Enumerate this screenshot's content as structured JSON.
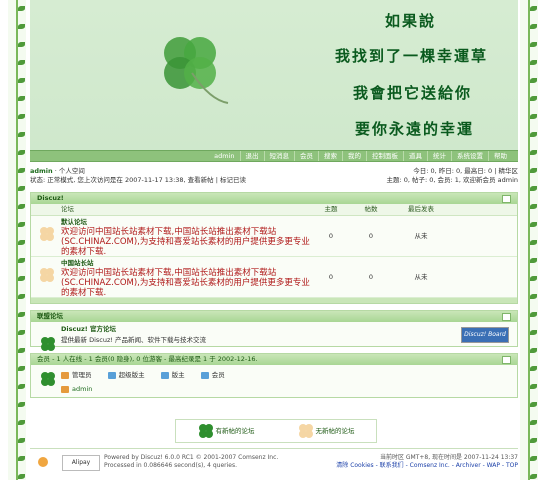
{
  "banner": {
    "poem_lines": [
      "如果說",
      "我找到了一棵幸運草",
      "我會把它送給你",
      "要你永遠的幸運"
    ]
  },
  "menu": [
    "admin",
    "退出",
    "短消息",
    "会员",
    "搜索",
    "我的",
    "控制面板",
    "道具",
    "统计",
    "系统设置",
    "帮助"
  ],
  "user": {
    "name": "admin",
    "space": "· 个人空间",
    "status": "状态: 正常模式, 您上次访问是在 2007-11-17 13:38, 查看新帖 | 标记已读",
    "today": "今日: 0, 昨日: 0, 最高日: 0 | 精华区",
    "stats": "主题: 0, 帖子: 0, 会员: 1, 欢迎新会员 admin"
  },
  "forum_box": {
    "title": "Discuz!",
    "columns": [
      "论坛",
      "主题",
      "帖数",
      "最后发表"
    ],
    "rows": [
      {
        "title": "默认论坛",
        "desc": "欢迎访问中国站长站素材下载,中国站长站推出素材下载站(SC.CHINAZ.COM),为支持和喜爱站长素材的用户提供更多更专业的素材下载.",
        "topics": "0",
        "posts": "0",
        "last": "从未"
      },
      {
        "title": "中国站长站",
        "desc": "欢迎访问中国站长站素材下载,中国站长站推出素材下载站(SC.CHINAZ.COM),为支持和喜爱站长素材的用户提供更多更专业的素材下载.",
        "topics": "0",
        "posts": "0",
        "last": "从未"
      }
    ]
  },
  "links_box": {
    "title": "联盟论坛",
    "name": "Discuz! 官方论坛",
    "desc": "提供最新 Discuz! 产品新闻、软件下载与技术交流",
    "banner_text": "Discuz! Board"
  },
  "members_box": {
    "title": "会员 - 1 人在线 - 1 会员(0 隐身), 0 位游客 - 最高纪录是 1 于 2002-12-16.",
    "groups": [
      "管理员",
      "超级版主",
      "版主",
      "会员"
    ],
    "online_user": "admin"
  },
  "legend": {
    "new": "有新帖的论坛",
    "no_new": "无新帖的论坛"
  },
  "footer": {
    "powered": "Powered by Discuz! 6.0.0 RC1 © 2001-2007 Comsenz Inc.",
    "processed": "Processed in 0.086646 second(s), 4 queries.",
    "alipay": "Alipay",
    "time": "当前时区 GMT+8, 现在时间是 2007-11-24 13:37",
    "links": "清除 Cookies - 联系我们 - Comsenz Inc. - Archiver - WAP - TOP"
  },
  "colors": {
    "accent": "#8ec27c",
    "header": "#a8d694",
    "text_red": "#b01a1a",
    "poem": "#0a5a1e"
  }
}
